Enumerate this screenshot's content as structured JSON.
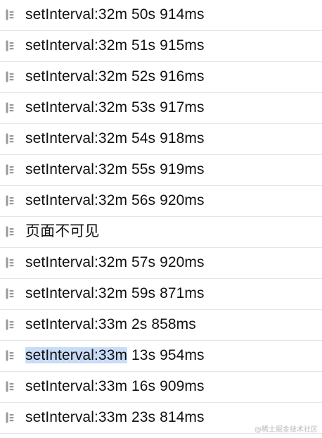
{
  "logs": [
    {
      "pre": "setInterval:32m 50s 914ms",
      "sel": "",
      "post": ""
    },
    {
      "pre": "setInterval:32m 51s 915ms",
      "sel": "",
      "post": ""
    },
    {
      "pre": "setInterval:32m 52s 916ms",
      "sel": "",
      "post": ""
    },
    {
      "pre": "setInterval:32m 53s 917ms",
      "sel": "",
      "post": ""
    },
    {
      "pre": "setInterval:32m 54s 918ms",
      "sel": "",
      "post": ""
    },
    {
      "pre": "setInterval:32m 55s 919ms",
      "sel": "",
      "post": ""
    },
    {
      "pre": "setInterval:32m 56s 920ms",
      "sel": "",
      "post": ""
    },
    {
      "pre": "页面不可见",
      "sel": "",
      "post": ""
    },
    {
      "pre": "setInterval:32m 57s 920ms",
      "sel": "",
      "post": ""
    },
    {
      "pre": "setInterval:32m 59s 871ms",
      "sel": "",
      "post": ""
    },
    {
      "pre": "setInterval:33m 2s 858ms",
      "sel": "",
      "post": ""
    },
    {
      "pre": "",
      "sel": "setInterval:33m",
      "post": " 13s 954ms"
    },
    {
      "pre": "setInterval:33m 16s 909ms",
      "sel": "",
      "post": ""
    },
    {
      "pre": "setInterval:33m 23s 814ms",
      "sel": "",
      "post": ""
    }
  ],
  "watermark": "@稀土掘金技术社区",
  "icon_name": "log-entry-icon",
  "colors": {
    "text": "#111111",
    "icon": "#9a9a9a",
    "divider": "#e6e6e6",
    "selection": "#c8dcf8"
  }
}
